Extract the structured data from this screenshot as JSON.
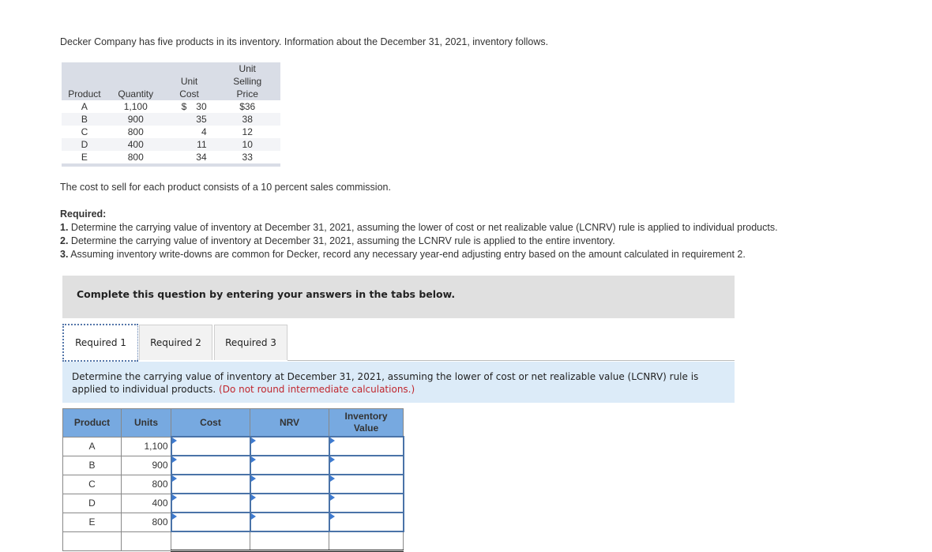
{
  "intro": "Decker Company has five products in its inventory. Information about the December 31, 2021, inventory follows.",
  "given_table": {
    "headers": {
      "product": "Product",
      "quantity": "Quantity",
      "unit_cost_l1": "Unit",
      "unit_cost_l2": "Cost",
      "usp_l1": "Unit",
      "usp_l2": "Selling",
      "usp_l3": "Price"
    },
    "rows": [
      {
        "product": "A",
        "quantity": "1,100",
        "cost_symbol": "$",
        "unit_cost": "30",
        "unit_selling_price": "$36"
      },
      {
        "product": "B",
        "quantity": "900",
        "cost_symbol": "",
        "unit_cost": "35",
        "unit_selling_price": "38"
      },
      {
        "product": "C",
        "quantity": "800",
        "cost_symbol": "",
        "unit_cost": "4",
        "unit_selling_price": "12"
      },
      {
        "product": "D",
        "quantity": "400",
        "cost_symbol": "",
        "unit_cost": "11",
        "unit_selling_price": "10"
      },
      {
        "product": "E",
        "quantity": "800",
        "cost_symbol": "",
        "unit_cost": "34",
        "unit_selling_price": "33"
      }
    ]
  },
  "cost_to_sell": "The cost to sell for each product consists of a 10 percent sales commission.",
  "required": {
    "heading": "Required:",
    "items": [
      {
        "num": "1.",
        "text": " Determine the carrying value of inventory at December 31, 2021, assuming the lower of cost or net realizable value (LCNRV) rule is applied to individual products."
      },
      {
        "num": "2.",
        "text": " Determine the carrying value of inventory at December 31, 2021, assuming the LCNRV rule is applied to the entire inventory."
      },
      {
        "num": "3.",
        "text": " Assuming inventory write-downs are common for Decker, record any necessary year-end adjusting entry based on the amount calculated in requirement 2."
      }
    ]
  },
  "banner": "Complete this question by entering your answers in the tabs below.",
  "tabs": [
    {
      "label": "Required 1",
      "active": true
    },
    {
      "label": "Required 2",
      "active": false
    },
    {
      "label": "Required 3",
      "active": false
    }
  ],
  "instructions": {
    "text": "Determine the carrying value of inventory at December 31, 2021, assuming the lower of cost or net realizable value (LCNRV) rule is applied to individual products. ",
    "note": "(Do not round intermediate calculations.)"
  },
  "answer_table": {
    "headers": {
      "product": "Product",
      "units": "Units",
      "cost": "Cost",
      "nrv": "NRV",
      "inventory_value_l1": "Inventory",
      "inventory_value_l2": "Value"
    },
    "rows": [
      {
        "product": "A",
        "units": "1,100",
        "cost": "",
        "nrv": "",
        "inventory_value": ""
      },
      {
        "product": "B",
        "units": "900",
        "cost": "",
        "nrv": "",
        "inventory_value": ""
      },
      {
        "product": "C",
        "units": "800",
        "cost": "",
        "nrv": "",
        "inventory_value": ""
      },
      {
        "product": "D",
        "units": "400",
        "cost": "",
        "nrv": "",
        "inventory_value": ""
      },
      {
        "product": "E",
        "units": "800",
        "cost": "",
        "nrv": "",
        "inventory_value": ""
      }
    ],
    "total": {
      "cost": "",
      "nrv": "",
      "inventory_value": ""
    }
  },
  "colors": {
    "header_blue": "#77a9e0",
    "input_border": "#4a73a8",
    "instruction_bg": "#dcebf8",
    "note_red": "#c0262d",
    "banner_bg": "#e0e0e0"
  }
}
